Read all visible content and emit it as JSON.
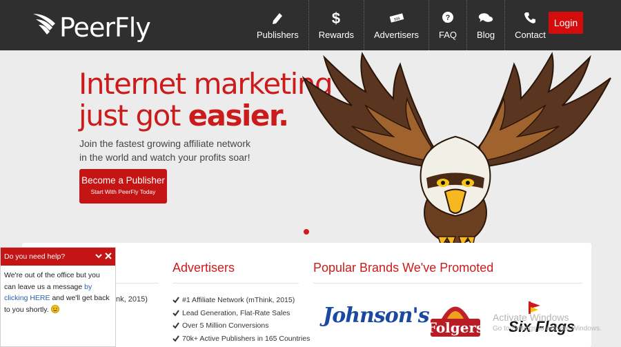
{
  "brand": {
    "name": "PeerFly"
  },
  "nav": {
    "items": [
      {
        "label": "Publishers",
        "icon": "pencil-icon"
      },
      {
        "label": "Rewards",
        "icon": "dollar-icon"
      },
      {
        "label": "Advertisers",
        "icon": "money-icon"
      },
      {
        "label": "FAQ",
        "icon": "question-icon"
      },
      {
        "label": "Blog",
        "icon": "chat-bubbles-icon"
      },
      {
        "label": "Contact",
        "icon": "phone-icon"
      }
    ],
    "login_label": "Login"
  },
  "hero": {
    "title_line1": "Internet marketing",
    "title_line2_plain": "just got ",
    "title_line2_bold": "easier.",
    "subtitle_line1": "Join the fastest growing affiliate network",
    "subtitle_line2": "in the world and watch your profits soar!",
    "cta_label": "Become a Publisher",
    "cta_sublabel": "Start With PeerFly Today"
  },
  "publishers_partial": {
    "text": "nk, 2015)"
  },
  "advertisers": {
    "title": "Advertisers",
    "items": [
      "#1 Affiliate Network (mThink, 2015)",
      "Lead Generation, Flat-Rate Sales",
      "Over 5 Million Conversions",
      "70k+ Active Publishers in 165 Countries"
    ]
  },
  "brands": {
    "title": "Popular Brands We've Promoted",
    "logos": [
      "Johnson's",
      "Folgers",
      "Six Flags"
    ]
  },
  "watermark": {
    "line1": "Activate Windows",
    "line2": "Go to Settings to activate Windows."
  },
  "chat": {
    "header": "Do you need help?",
    "body_before": "We're out of the office but you can leave us a message ",
    "link": "by clicking HERE",
    "body_after": " and we'll get back to you shortly."
  },
  "colors": {
    "accent": "#cc1b1b",
    "header_bg": "#2f2f2f",
    "button": "#d40c0c"
  }
}
